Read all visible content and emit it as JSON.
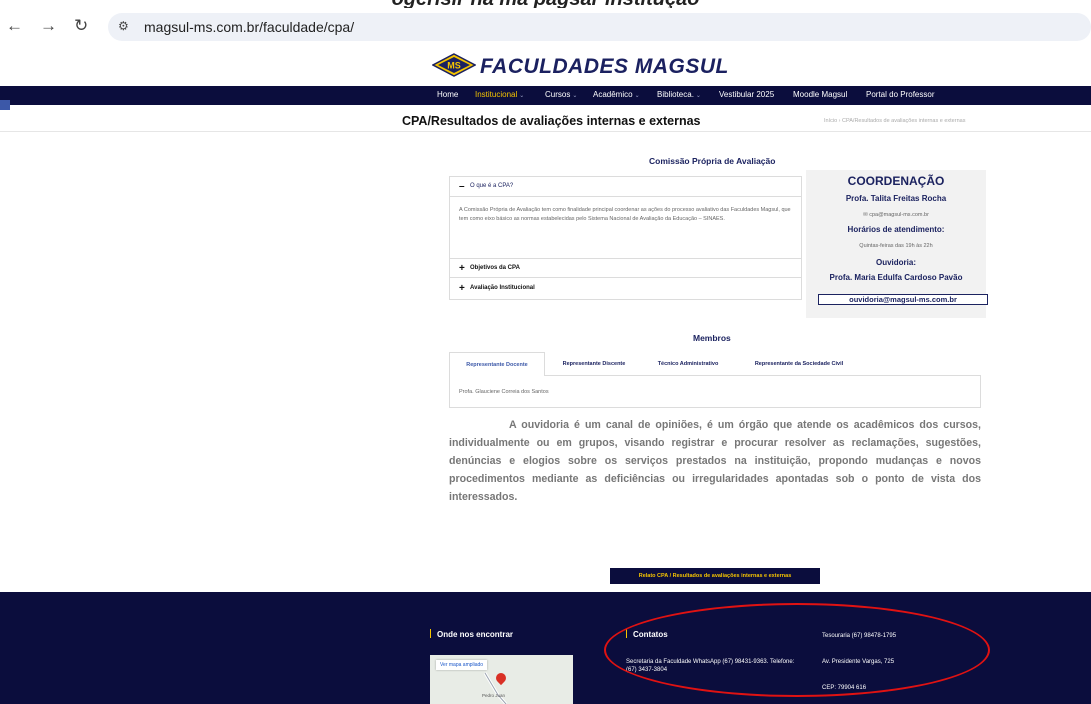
{
  "caption": "ogerisir na ma pagsar institução",
  "browser": {
    "back_icon": "back-arrow-icon",
    "forward_icon": "forward-arrow-icon",
    "reload_icon": "reload-icon",
    "site_info_icon": "tune-icon",
    "url": "magsul-ms.com.br/faculdade/cpa/"
  },
  "logo": {
    "text": "FACULDADES MAGSUL",
    "emblem": "MS"
  },
  "nav": {
    "items": [
      "Home",
      "Institucional",
      "Cursos",
      "Acadêmico",
      "Biblioteca.",
      "Vestibular 2025",
      "Moodle Magsul",
      "Portal do Professor"
    ]
  },
  "page": {
    "title": "CPA/Resultados de avaliações internas e externas",
    "breadcrumb": "Início  ›  CPA/Resultados de avaliações internas e externas"
  },
  "cpa": {
    "heading": "Comissão Própria de Avaliação",
    "accordion": [
      {
        "label": "O que é a CPA?",
        "body": "A Comissão Própria de Avaliação tem como finalidade principal coordenar as ações do processo avaliativo das Faculdades Magsul, que tem como eixo básico as normas estabelecidas pelo Sistema Nacional de Avaliação da Educação – SINAES."
      },
      {
        "label": "Objetivos da CPA"
      },
      {
        "label": "Avaliação Institucional"
      }
    ]
  },
  "coordination": {
    "title": "COORDENAÇÃO",
    "name": "Profa. Talita Freitas Rocha",
    "email": "✉ cpa@magsul-ms.com.br",
    "hours_title": "Horários de atendimento:",
    "hours": "Quintas-feiras das 19h às 22h",
    "ouvidoria_title": "Ouvidoria:",
    "ouvidoria_name": "Profa. Maria Edulfa Cardoso Pavão",
    "ouvidoria_email": "ouvidoria@magsul-ms.com.br"
  },
  "members": {
    "heading": "Membros",
    "tabs": [
      "Representante Docente",
      "Representante Discente",
      "Técnico Administrativo",
      "Representante da Sociedade Civil"
    ],
    "active_content": "Profa.  Glauciene Correia dos Santos"
  },
  "ouvidoria_paragraph": "A ouvidoria é um canal de opiniões, é um órgão que atende os acadêmicos dos cursos, individualmente ou em grupos, visando registrar e procurar resolver as reclamações, sugestões, denúncias e elogios sobre os serviços prestados na instituição, propondo mudanças e novos procedimentos mediante as deficiências ou irregularidades apontadas sob o ponto de vista dos interessados.",
  "report_button": "Relato CPA / Resultados de avaliações internas e externas",
  "footer": {
    "find_us_heading": "Onde nos encontrar",
    "map_link": "Ver mapa ampliado",
    "map_place": "Pedro Juan",
    "contacts_heading": "Contatos",
    "secretaria": "Secretaria da Faculdade  WhatsApp (67) 98431-9363. Telefone: (67) 3437-3804",
    "tesouraria": "Tesouraria (67)  98478-1795",
    "address": "Av. Presidente Vargas, 725",
    "cep": "CEP: 79904 616"
  },
  "colors": {
    "navy": "#0b0d3d",
    "gold": "#f5c400",
    "annotation_red": "#e01212"
  }
}
